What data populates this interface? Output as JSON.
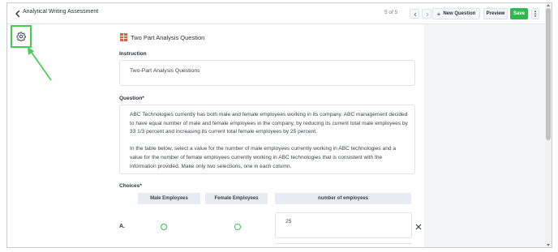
{
  "header": {
    "title": "Analytical Writing Assessment",
    "pager": "5 of 5",
    "new_question_label": "New Question",
    "preview_label": "Preview",
    "save_label": "Save"
  },
  "question_header": {
    "title": "Two Part Analysis Question",
    "icon": "table-grid-icon"
  },
  "instruction": {
    "label": "Instruction",
    "value": "Two-Part Analysis Questions"
  },
  "question": {
    "label": "Question*",
    "paragraphs": [
      "ABC Technologies currently has both male and female employees working in its company. ABC management decided to have equal number of male and female employees in the company, by reducing its current total male employees by 33 1/3 percent and increasing its current total female employees by 25 percent.",
      "In the table below, select a value for the number of male employees currently working in ABC technologies and a value for the number of female employees currently working in ABC technologies that is consistent with the information provided. Make only two selections, one in each column."
    ]
  },
  "choices": {
    "label": "Choices*",
    "columns": [
      "Male Employees",
      "Female Employees",
      "number of employees"
    ],
    "rows": [
      {
        "label": "A.",
        "value": "25"
      }
    ]
  },
  "colors": {
    "accent_green": "#2fb84f",
    "highlight_green": "#3fcf4a",
    "header_cell_bg": "#e8ecf2"
  }
}
